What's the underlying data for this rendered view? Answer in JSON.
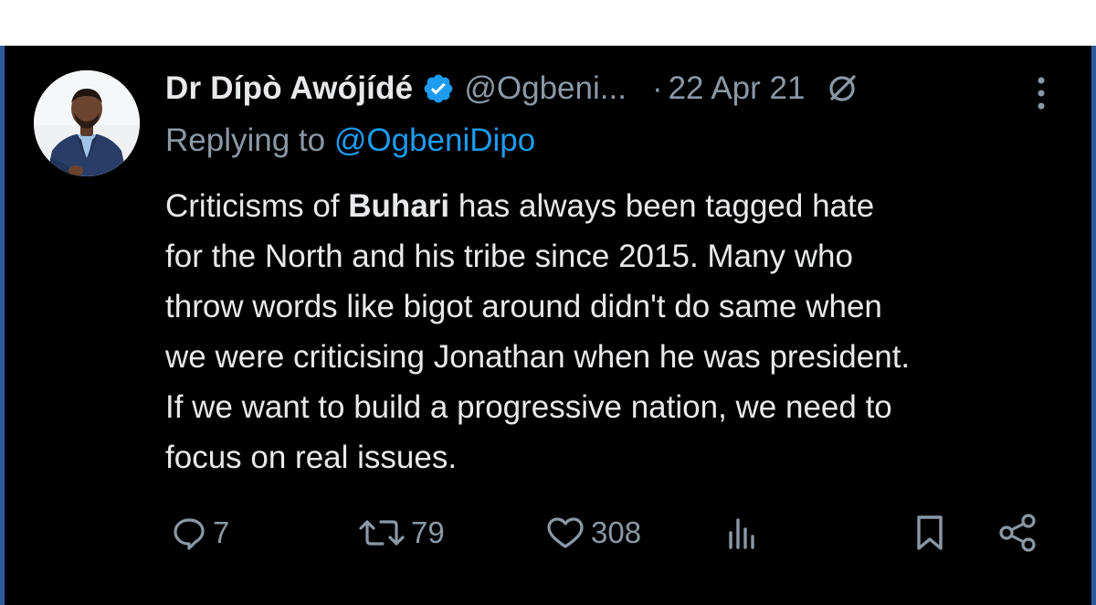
{
  "tweet": {
    "author": {
      "display_name": "Dr Dípò Awójídé",
      "handle": "@Ogbeni...",
      "verified": true
    },
    "separator": "·",
    "date": "22 Apr 21",
    "replying_to": {
      "prefix": "Replying to",
      "handle": "@OgbeniDipo"
    },
    "text_lines": {
      "line1_before": "Criticisms of ",
      "line1_bold": "Buhari",
      "line1_after": " has always been tagged hate",
      "line2": "for the North and his tribe since 2015. Many who",
      "line3": "throw words like bigot around didn't do same when",
      "line4": "we were criticising Jonathan when he was president.",
      "line5": "If we want to build a progressive nation, we need to",
      "line6": "focus on real issues."
    },
    "stats": {
      "replies": "7",
      "retweets": "79",
      "likes": "308"
    }
  },
  "icons": {
    "verified": "verified-badge-icon",
    "grok": "grok-icon",
    "more": "more-vertical-icon",
    "reply": "reply-icon",
    "retweet": "retweet-icon",
    "like": "heart-icon",
    "views": "views-icon",
    "bookmark": "bookmark-icon",
    "share": "share-icon"
  },
  "colors": {
    "background": "#000000",
    "text": "#e7e9ea",
    "secondary": "#8b98a5",
    "link": "#1d9bf0",
    "verified": "#1d9bf0"
  }
}
